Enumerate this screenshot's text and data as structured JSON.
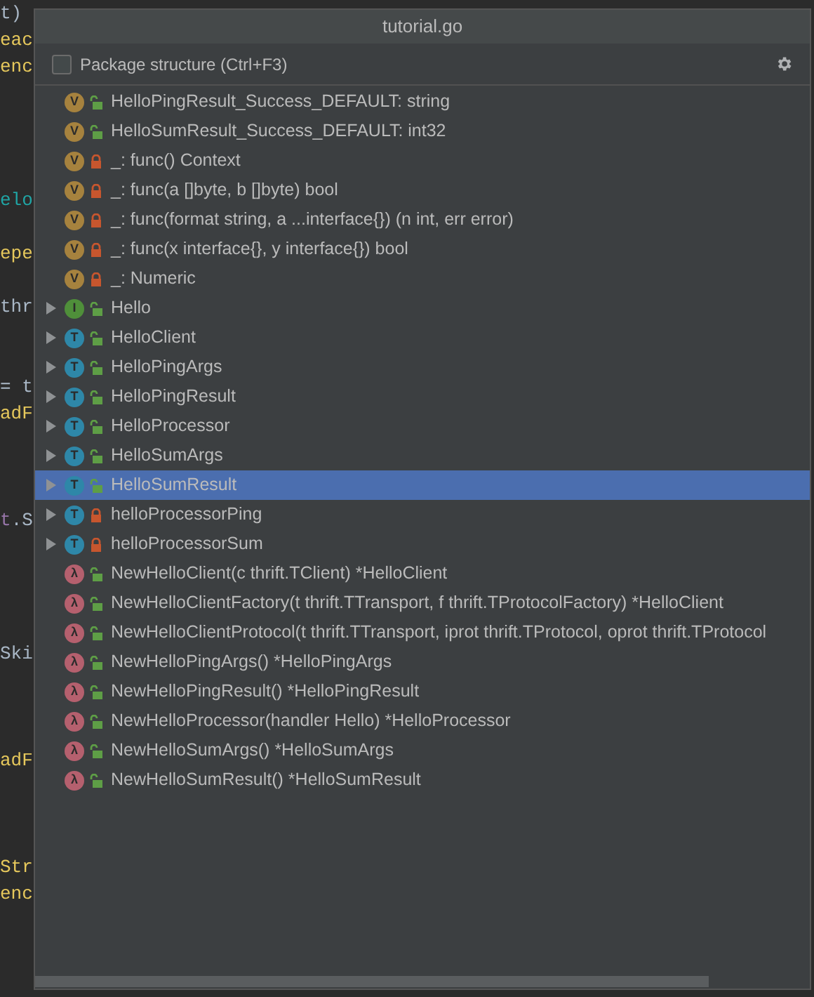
{
  "editor": {
    "lines": [
      {
        "kind": "code",
        "segments": [
          {
            "text": "t)",
            "kind": "plain"
          }
        ]
      },
      {
        "kind": "code",
        "segments": [
          {
            "text": "eac",
            "kind": "call"
          }
        ]
      },
      {
        "kind": "code",
        "segments": [
          {
            "text": "enc",
            "kind": "call"
          }
        ]
      },
      {
        "kind": "blank"
      },
      {
        "kind": "blank"
      },
      {
        "kind": "blank"
      },
      {
        "kind": "blank"
      },
      {
        "kind": "code",
        "segments": [
          {
            "text": "elo",
            "kind": "type"
          }
        ]
      },
      {
        "kind": "blank"
      },
      {
        "kind": "code",
        "segments": [
          {
            "text": "epe",
            "kind": "call"
          }
        ]
      },
      {
        "kind": "blank"
      },
      {
        "kind": "code",
        "segments": [
          {
            "text": "thr",
            "kind": "plain"
          }
        ]
      },
      {
        "kind": "blank"
      },
      {
        "kind": "blank"
      },
      {
        "kind": "code",
        "segments": [
          {
            "text": "= t",
            "kind": "plain"
          }
        ]
      },
      {
        "kind": "code",
        "segments": [
          {
            "text": "adF",
            "kind": "call"
          }
        ]
      },
      {
        "kind": "blank"
      },
      {
        "kind": "blank"
      },
      {
        "kind": "blank"
      },
      {
        "kind": "code",
        "segments": [
          {
            "text": "t",
            "kind": "variable"
          },
          {
            "text": ".S",
            "kind": "plain"
          }
        ]
      },
      {
        "kind": "blank"
      },
      {
        "kind": "blank"
      },
      {
        "kind": "blank"
      },
      {
        "kind": "blank"
      },
      {
        "kind": "code",
        "segments": [
          {
            "text": "Ski",
            "kind": "plain"
          }
        ]
      },
      {
        "kind": "blank"
      },
      {
        "kind": "blank"
      },
      {
        "kind": "blank"
      },
      {
        "kind": "code",
        "segments": [
          {
            "text": "adF",
            "kind": "call"
          }
        ]
      },
      {
        "kind": "blank"
      },
      {
        "kind": "blank"
      },
      {
        "kind": "blank"
      },
      {
        "kind": "code",
        "segments": [
          {
            "text": "Str",
            "kind": "call"
          }
        ]
      },
      {
        "kind": "code",
        "segments": [
          {
            "text": "enc",
            "kind": "call"
          }
        ]
      }
    ]
  },
  "popup": {
    "title": "tutorial.go",
    "package_structure": {
      "label": "Package structure (Ctrl+F3)",
      "checked": false
    },
    "items": [
      {
        "kind": "variable",
        "badge": "V",
        "public": true,
        "expandable": false,
        "selected": false,
        "label": "HelloPingResult_Success_DEFAULT: string"
      },
      {
        "kind": "variable",
        "badge": "V",
        "public": true,
        "expandable": false,
        "selected": false,
        "label": "HelloSumResult_Success_DEFAULT: int32"
      },
      {
        "kind": "variable",
        "badge": "V",
        "public": false,
        "expandable": false,
        "selected": false,
        "label": "_: func() Context"
      },
      {
        "kind": "variable",
        "badge": "V",
        "public": false,
        "expandable": false,
        "selected": false,
        "label": "_: func(a []byte, b []byte) bool"
      },
      {
        "kind": "variable",
        "badge": "V",
        "public": false,
        "expandable": false,
        "selected": false,
        "label": "_: func(format string, a ...interface{}) (n int, err error)"
      },
      {
        "kind": "variable",
        "badge": "V",
        "public": false,
        "expandable": false,
        "selected": false,
        "label": "_: func(x interface{}, y interface{}) bool"
      },
      {
        "kind": "variable",
        "badge": "V",
        "public": false,
        "expandable": false,
        "selected": false,
        "label": "_: Numeric"
      },
      {
        "kind": "interface",
        "badge": "I",
        "public": true,
        "expandable": true,
        "selected": false,
        "label": "Hello"
      },
      {
        "kind": "type",
        "badge": "T",
        "public": true,
        "expandable": true,
        "selected": false,
        "label": "HelloClient"
      },
      {
        "kind": "type",
        "badge": "T",
        "public": true,
        "expandable": true,
        "selected": false,
        "label": "HelloPingArgs"
      },
      {
        "kind": "type",
        "badge": "T",
        "public": true,
        "expandable": true,
        "selected": false,
        "label": "HelloPingResult"
      },
      {
        "kind": "type",
        "badge": "T",
        "public": true,
        "expandable": true,
        "selected": false,
        "label": "HelloProcessor"
      },
      {
        "kind": "type",
        "badge": "T",
        "public": true,
        "expandable": true,
        "selected": false,
        "label": "HelloSumArgs"
      },
      {
        "kind": "type",
        "badge": "T",
        "public": true,
        "expandable": true,
        "selected": true,
        "label": "HelloSumResult"
      },
      {
        "kind": "type",
        "badge": "T",
        "public": false,
        "expandable": true,
        "selected": false,
        "label": "helloProcessorPing"
      },
      {
        "kind": "type",
        "badge": "T",
        "public": false,
        "expandable": true,
        "selected": false,
        "label": "helloProcessorSum"
      },
      {
        "kind": "function",
        "badge": "λ",
        "public": true,
        "expandable": false,
        "selected": false,
        "label": "NewHelloClient(c thrift.TClient) *HelloClient"
      },
      {
        "kind": "function",
        "badge": "λ",
        "public": true,
        "expandable": false,
        "selected": false,
        "label": "NewHelloClientFactory(t thrift.TTransport, f thrift.TProtocolFactory) *HelloClient"
      },
      {
        "kind": "function",
        "badge": "λ",
        "public": true,
        "expandable": false,
        "selected": false,
        "label": "NewHelloClientProtocol(t thrift.TTransport, iprot thrift.TProtocol, oprot thrift.TProtocol"
      },
      {
        "kind": "function",
        "badge": "λ",
        "public": true,
        "expandable": false,
        "selected": false,
        "label": "NewHelloPingArgs() *HelloPingArgs"
      },
      {
        "kind": "function",
        "badge": "λ",
        "public": true,
        "expandable": false,
        "selected": false,
        "label": "NewHelloPingResult() *HelloPingResult"
      },
      {
        "kind": "function",
        "badge": "λ",
        "public": true,
        "expandable": false,
        "selected": false,
        "label": "NewHelloProcessor(handler Hello) *HelloProcessor"
      },
      {
        "kind": "function",
        "badge": "λ",
        "public": true,
        "expandable": false,
        "selected": false,
        "label": "NewHelloSumArgs() *HelloSumArgs"
      },
      {
        "kind": "function",
        "badge": "λ",
        "public": true,
        "expandable": false,
        "selected": false,
        "label": "NewHelloSumResult() *HelloSumResult"
      }
    ]
  }
}
